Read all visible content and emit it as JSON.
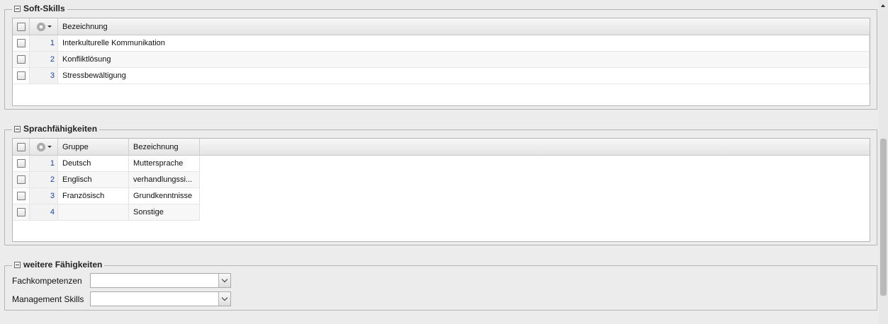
{
  "soft_skills": {
    "title": "Soft-Skills",
    "columns": [
      "Bezeichnung"
    ],
    "rows": [
      {
        "num": "1",
        "bezeichnung": "Interkulturelle Kommunikation"
      },
      {
        "num": "2",
        "bezeichnung": "Konfliktlösung"
      },
      {
        "num": "3",
        "bezeichnung": "Stressbewältigung"
      }
    ]
  },
  "sprach": {
    "title": "Sprachfähigkeiten",
    "columns": [
      "Gruppe",
      "Bezeichnung"
    ],
    "rows": [
      {
        "num": "1",
        "gruppe": "Deutsch",
        "bezeichnung": "Muttersprache"
      },
      {
        "num": "2",
        "gruppe": "Englisch",
        "bezeichnung": "verhandlungssi..."
      },
      {
        "num": "3",
        "gruppe": "Französisch",
        "bezeichnung": "Grundkenntnisse"
      },
      {
        "num": "4",
        "gruppe": "",
        "bezeichnung": "Sonstige"
      }
    ]
  },
  "weitere": {
    "title": "weitere Fähigkeiten",
    "fachkompetenzen_label": "Fachkompetenzen",
    "fachkompetenzen_value": "",
    "management_label": "Management Skills",
    "management_value": ""
  }
}
